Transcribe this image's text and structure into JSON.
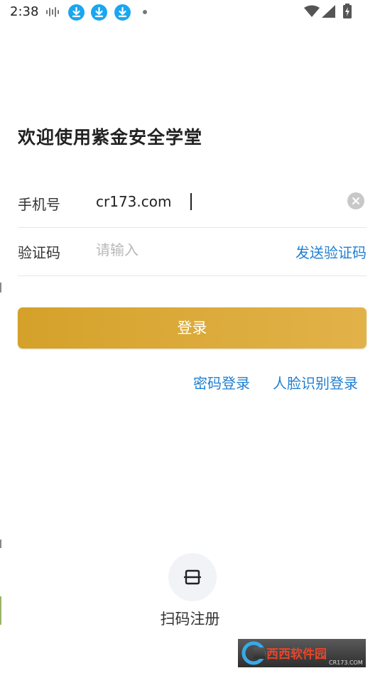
{
  "status_bar": {
    "time": "2:38",
    "icons": [
      "audio-wave-icon",
      "download-icon",
      "download-icon",
      "download-icon",
      "notification-dot-icon",
      "wifi-icon",
      "signal-icon",
      "battery-charging-icon"
    ],
    "accent_color": "#1aa6f0"
  },
  "title": "欢迎使用紫金安全学堂",
  "phone_row": {
    "label": "手机号",
    "value": "cr173.com"
  },
  "code_row": {
    "label": "验证码",
    "placeholder": "请输入",
    "send_label": "发送验证码"
  },
  "login_button": {
    "label": "登录",
    "color": "#d4a22a"
  },
  "links": {
    "password_login": "密码登录",
    "face_login": "人脸识别登录",
    "link_color": "#1f7fd2"
  },
  "scan_register": {
    "icon": "scan-icon",
    "label": "扫码注册"
  },
  "watermark": {
    "brand": "西西软件园",
    "domain": "CR173.COM"
  }
}
